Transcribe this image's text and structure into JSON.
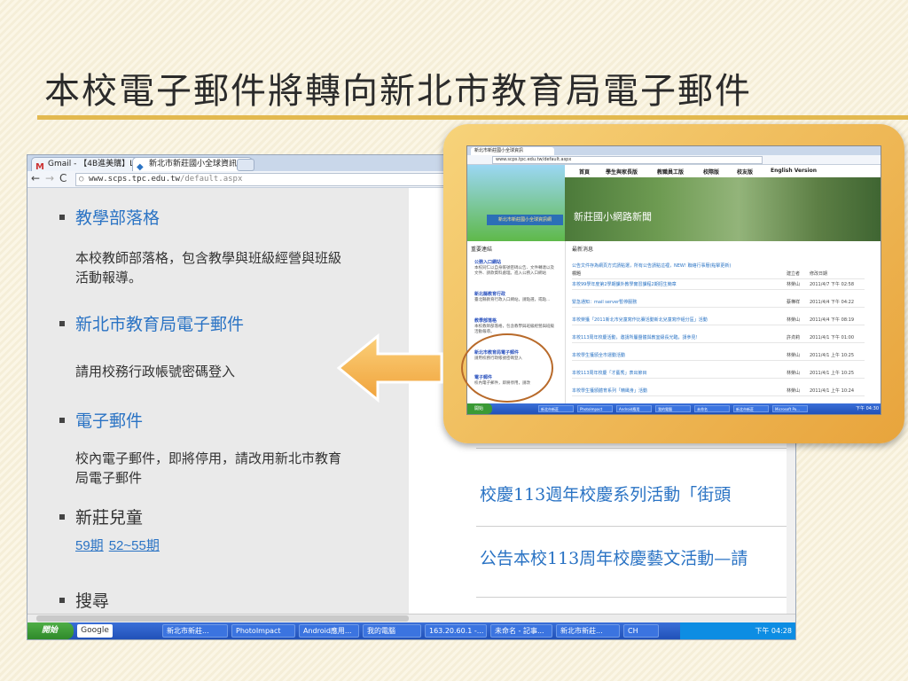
{
  "slide": {
    "title": "本校電子郵件將轉向新北市教育局電子郵件"
  },
  "browser": {
    "tabs": [
      {
        "label": "Gmail - 【4B進美購】LE..."
      },
      {
        "label": "新北市新莊國小全球資訊..."
      }
    ],
    "url_host": "www.scps.tpc.edu.tw",
    "url_path": "/default.aspx"
  },
  "left_pane": {
    "sections": [
      {
        "title": "教學部落格",
        "desc": "本校教師部落格，包含教學與班級經營與班級活動報導。"
      },
      {
        "title": "新北市教育局電子郵件",
        "desc": "請用校務行政帳號密碼登入"
      },
      {
        "title": "電子郵件",
        "desc": "校內電子郵件，即將停用，請改用新北市教育局電子郵件"
      },
      {
        "title": "新莊兒童",
        "issues": [
          "59期",
          "52~55期"
        ]
      },
      {
        "title": "搜尋"
      }
    ]
  },
  "right_pane": {
    "news": [
      "校慶113週年校慶系列活動「街頭",
      "公告本校113周年校慶藝文活動—請"
    ]
  },
  "taskbar": {
    "start": "開始",
    "google": "Google",
    "items": [
      "新北市新莊...",
      "PhotoImpact",
      "Android應用...",
      "我的電腦",
      "163.20.60.1 -...",
      "未命名 - 記事...",
      "新北市新莊...",
      "CH"
    ],
    "clock": "下午 04:28"
  },
  "inset": {
    "tab": "新北市新莊國小全球資訊",
    "url": "www.scps.tpc.edu.tw/default.aspx",
    "menu": [
      "首頁",
      "學生與家長版",
      "教職員工版",
      "校際版",
      "校友版",
      "English Version"
    ],
    "banner_title": "新莊國小網路新聞",
    "school": "新北市新莊國小全球資訊網",
    "side_title": "重要連結",
    "side_items": [
      {
        "title": "公務入口網站",
        "desc": "本校同仁以自身帳號密碼公告、文件轉達以及文件、請款資料處理。進入公務入口網站"
      },
      {
        "title": "新北縣教育行政",
        "desc": "臺北縣教育行政入口網站，請點選，或點..."
      },
      {
        "title": "教學部落格",
        "desc": "本校教師部落格，包含教學與班級經營與班級活動報導。"
      },
      {
        "title": "新北市教育局電子郵件",
        "desc": "請用校務行政帳號密碼登入"
      },
      {
        "title": "電子郵件",
        "desc": "校內電子郵件，即將停用，請改"
      }
    ],
    "main_title": "最新消息",
    "notice": "公告文件存為網頁方式請點選，所有公告請點這裡，NEW! 聯絡行事曆(點擊更新)",
    "col_header": [
      "標題",
      "建立者",
      "修改日期"
    ],
    "rows": [
      {
        "title": "本校99學年度第2學期課外教學實習課程2期招生簡章",
        "author": "林榮山",
        "date": "2011/4/7 下午 02:58"
      },
      {
        "title": "緊急通知：mail server暫停服務",
        "author": "蔡樺祥",
        "date": "2011/4/4 下午 04:22"
      },
      {
        "title": "本校榮獲「2011新北市兒童寫作比賽活動新北兒童寫作組分區」活動",
        "author": "林榮山",
        "date": "2011/4/4 下午 08:19"
      },
      {
        "title": "本校113周年校慶活動，邀請所屬團體與教室級長光臨，請參見！",
        "author": "許貞莉",
        "date": "2011/4/1 下午 01:00"
      },
      {
        "title": "本校學生獲頒全市運動活動",
        "author": "林榮山",
        "date": "2011/4/1 上午 10:25"
      },
      {
        "title": "本校113周年校慶「才藝秀」表出節目",
        "author": "林榮山",
        "date": "2011/4/1 上午 10:25"
      },
      {
        "title": "本校學生獲頒體育系列「精緻身」活動",
        "author": "林榮山",
        "date": "2011/4/1 上午 10:24"
      }
    ],
    "start": "開始",
    "taskbar_items": [
      "新北市新莊",
      "PhotoImpact",
      "Android應用",
      "我的電腦",
      "未命名",
      "新北市新莊",
      "Microsoft Po..."
    ],
    "clock": "下午 04:30"
  },
  "colors": {
    "link": "#2a73c4",
    "accent": "#e3b94f",
    "arrow": "#f4b046"
  }
}
